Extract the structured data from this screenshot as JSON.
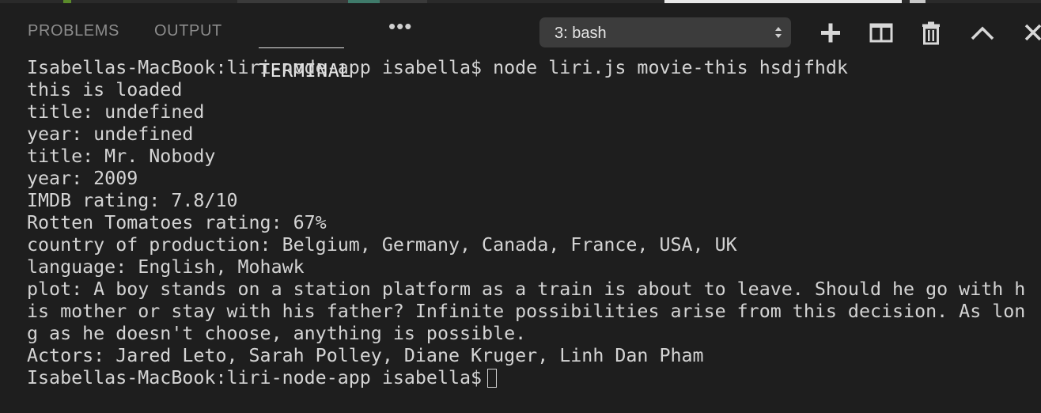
{
  "panel": {
    "tabs": [
      {
        "label": "PROBLEMS"
      },
      {
        "label": "OUTPUT"
      },
      {
        "label": "TERMINAL"
      }
    ],
    "active_tab": "TERMINAL",
    "more_label": "•••",
    "terminal_select": {
      "value": "3: bash"
    },
    "icons": [
      "plus-icon",
      "split-icon",
      "trash-icon",
      "chevron-up-icon",
      "close-icon"
    ]
  },
  "terminal": {
    "lines": [
      "Isabellas-MacBook:liri-node-app isabella$ node liri.js movie-this hsdjfhdk",
      "this is loaded",
      "title: undefined",
      "year: undefined",
      "title: Mr. Nobody",
      "year: 2009",
      "IMDB rating: 7.8/10",
      "Rotten Tomatoes rating: 67%",
      "country of production: Belgium, Germany, Canada, France, USA, UK",
      "language: English, Mohawk",
      "plot: A boy stands on a station platform as a train is about to leave. Should he go with h",
      "is mother or stay with his father? Infinite possibilities arise from this decision. As lon",
      "g as he doesn't choose, anything is possible.",
      "Actors: Jared Leto, Sarah Polley, Diane Kruger, Linh Dan Pham"
    ],
    "prompt": "Isabellas-MacBook:liri-node-app isabella$"
  },
  "colors": {
    "background": "#1e1e1e",
    "text": "#d4d4d4",
    "tab_inactive": "#8c8c8c",
    "tab_active": "#e8e8e8",
    "select_bg": "#3c3c3c"
  }
}
